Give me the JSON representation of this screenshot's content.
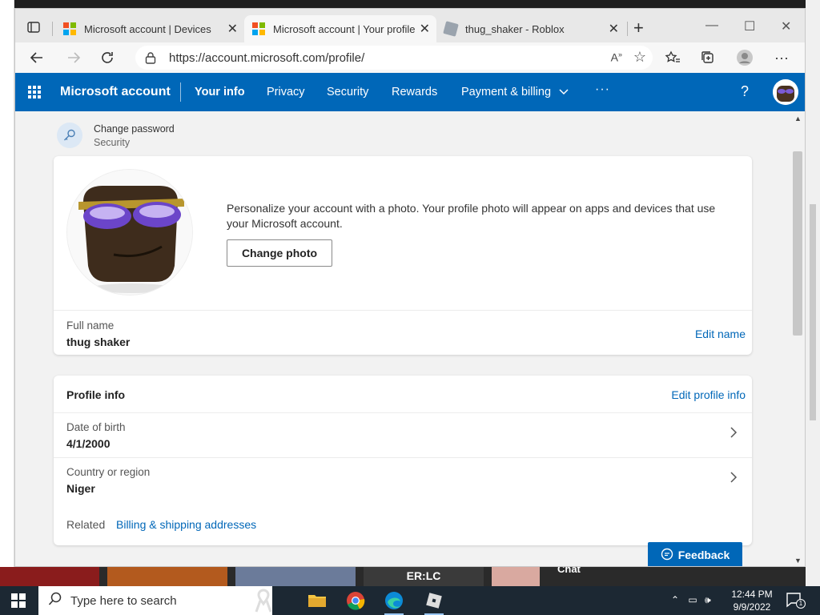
{
  "browser": {
    "tabs": [
      {
        "title": "Microsoft account | Devices",
        "favicon": "microsoft-logo-icon"
      },
      {
        "title": "Microsoft account | Your profile",
        "favicon": "microsoft-logo-icon",
        "active": true
      },
      {
        "title": "thug_shaker - Roblox",
        "favicon": "roblox-icon"
      }
    ],
    "url": "https://account.microsoft.com/profile/",
    "colors": {
      "accent": "#0067b8",
      "nav_bg": "#0067b8",
      "tab_bar": "#e8e8e8"
    }
  },
  "msnav": {
    "brand": "Microsoft account",
    "links": [
      "Your info",
      "Privacy",
      "Security",
      "Rewards",
      "Payment & billing"
    ],
    "more": "···",
    "help": "?"
  },
  "password": {
    "title": "Change password",
    "subtitle": "Security"
  },
  "photo_card": {
    "description": "Personalize your account with a photo. Your profile photo will appear on apps and devices that use your Microsoft account.",
    "button": "Change photo",
    "full_name_label": "Full name",
    "full_name": "thug shaker",
    "edit_name": "Edit name"
  },
  "profile_info": {
    "heading": "Profile info",
    "edit": "Edit profile info",
    "rows": [
      {
        "label": "Date of birth",
        "value": "4/1/2000"
      },
      {
        "label": "Country or region",
        "value": "Niger"
      }
    ],
    "related_label": "Related",
    "related_link": "Billing & shipping addresses"
  },
  "feedback": "Feedback",
  "background": {
    "chat": "Chat",
    "tile_text": "ER:LC"
  },
  "taskbar": {
    "search_placeholder": "Type here to search",
    "time": "12:44 PM",
    "date": "9/9/2022",
    "notifications": "1"
  }
}
